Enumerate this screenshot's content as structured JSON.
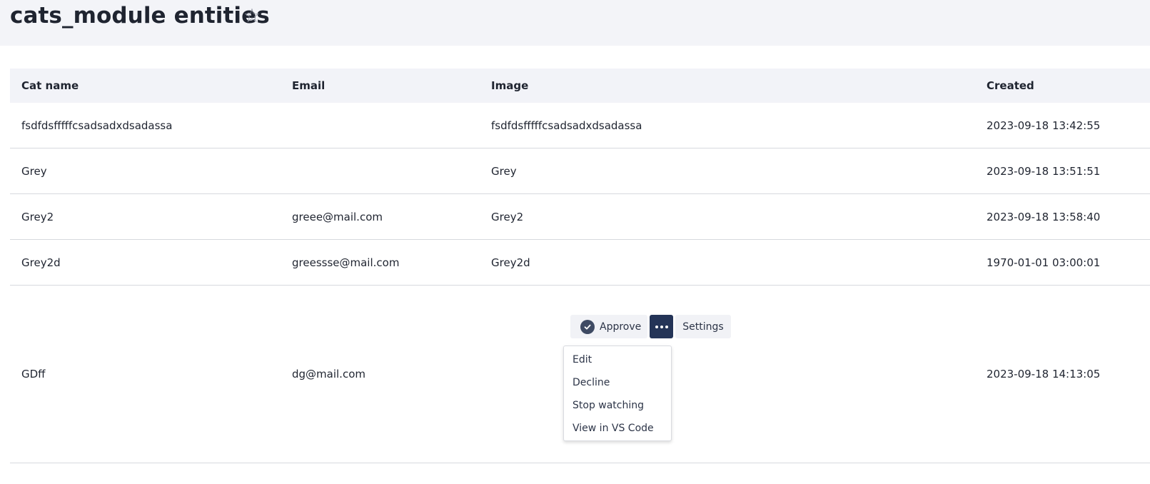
{
  "page": {
    "title": "cats_module entities",
    "star_icon": "star-outline-icon"
  },
  "table": {
    "columns": [
      "Cat name",
      "Email",
      "Image",
      "Created"
    ],
    "rows": [
      {
        "name": "fsdfdsfffffcsadsadxdsadassa",
        "email": "",
        "image": "fsdfdsfffffcsadsadxdsadassa",
        "created": "2023-09-18 13:42:55"
      },
      {
        "name": "Grey",
        "email": "",
        "image": "Grey",
        "created": "2023-09-18 13:51:51"
      },
      {
        "name": "Grey2",
        "email": "greee@mail.com",
        "image": "Grey2",
        "created": "2023-09-18 13:58:40"
      },
      {
        "name": "Grey2d",
        "email": "greessse@mail.com",
        "image": "Grey2d",
        "created": "1970-01-01 03:00:01"
      },
      {
        "name": "GDff",
        "email": "dg@mail.com",
        "image": "",
        "created": "2023-09-18 14:13:05"
      }
    ]
  },
  "actions": {
    "approve_label": "Approve",
    "more_icon": "more-dots-icon",
    "settings_label": "Settings",
    "menu": [
      "Edit",
      "Decline",
      "Stop watching",
      "View in VS Code"
    ]
  },
  "colors": {
    "header_bg": "#f3f4f8",
    "table_header_bg": "#f2f3f8",
    "primary_button": "#243457",
    "approve_check": "#3e4a63"
  }
}
